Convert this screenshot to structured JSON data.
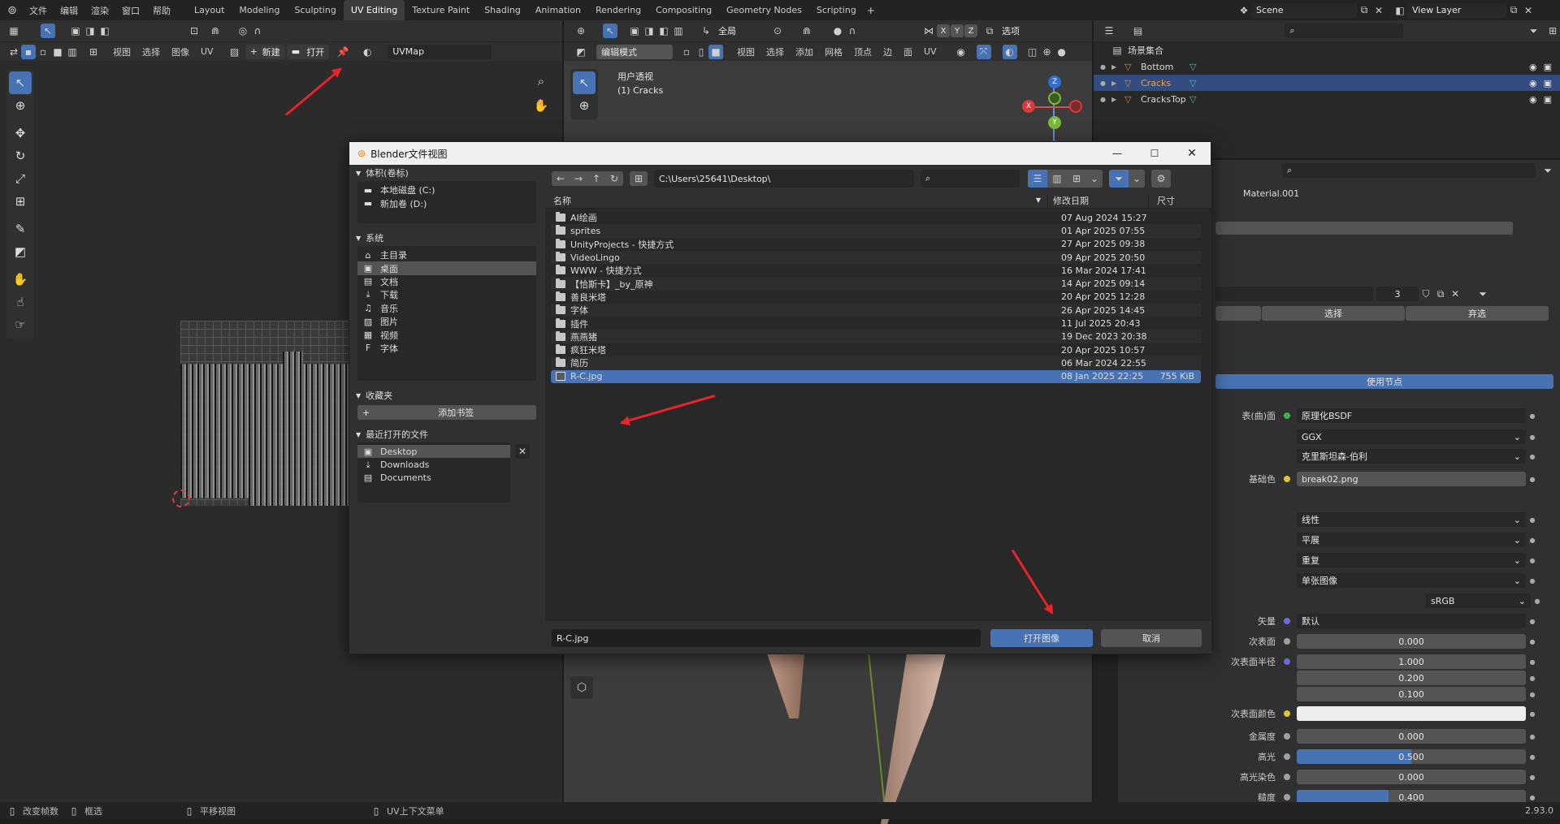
{
  "topbar": {
    "menus": [
      "文件",
      "编辑",
      "渲染",
      "窗口",
      "帮助"
    ],
    "workspaces": [
      "Layout",
      "Modeling",
      "Sculpting",
      "UV Editing",
      "Texture Paint",
      "Shading",
      "Animation",
      "Rendering",
      "Compositing",
      "Geometry Nodes",
      "Scripting"
    ],
    "active_workspace": "UV Editing",
    "scene": "Scene",
    "view_layer": "View Layer"
  },
  "uv_editor": {
    "menus": [
      "视图",
      "选择",
      "图像",
      "UV"
    ],
    "new_label": "新建",
    "open_label": "打开",
    "uvmap": "UVMap"
  },
  "viewport": {
    "mode": "编辑模式",
    "menus": [
      "视图",
      "选择",
      "添加",
      "网格",
      "顶点",
      "边",
      "面",
      "UV"
    ],
    "transform": "全局",
    "options": "选项",
    "overlay_title": "用户透视",
    "overlay_object": "(1) Cracks",
    "axes": [
      "X",
      "Y",
      "Z"
    ]
  },
  "outliner": {
    "root": "场景集合",
    "items": [
      "Bottom",
      "Cracks",
      "CracksTop"
    ],
    "selected": "Cracks"
  },
  "properties": {
    "material": "Material.001",
    "slot_count": "3",
    "select_label": "选择",
    "deselect_label": "弃选",
    "use_nodes": "使用节点",
    "rows": [
      {
        "label": "表(曲)面",
        "value": "原理化BSDF",
        "kind": "field",
        "dot": "#3fb04e"
      },
      {
        "label": "",
        "value": "GGX",
        "kind": "dropdown"
      },
      {
        "label": "",
        "value": "克里斯坦森-伯利",
        "kind": "dropdown"
      },
      {
        "label": "基础色",
        "value": "break02.png",
        "kind": "field",
        "dot": "#d8c63a"
      },
      {
        "label": "",
        "value": "线性",
        "kind": "dropdown"
      },
      {
        "label": "",
        "value": "平展",
        "kind": "dropdown"
      },
      {
        "label": "",
        "value": "重复",
        "kind": "dropdown"
      },
      {
        "label": "",
        "value": "单张图像",
        "kind": "dropdown"
      },
      {
        "label": "",
        "value": "sRGB",
        "kind": "dropdown"
      },
      {
        "label": "矢量",
        "value": "默认",
        "kind": "field",
        "dot": "#6a6ad8"
      },
      {
        "label": "次表面",
        "value": "0.000",
        "kind": "num",
        "dot": "#a0a0a0"
      },
      {
        "label": "次表面半径",
        "value": "1.000",
        "kind": "num",
        "dot": "#6a6ad8"
      },
      {
        "label": "",
        "value": "0.200",
        "kind": "num"
      },
      {
        "label": "",
        "value": "0.100",
        "kind": "num"
      },
      {
        "label": "次表面颜色",
        "value": "",
        "kind": "color",
        "dot": "#d8c63a"
      },
      {
        "label": "金属度",
        "value": "0.000",
        "kind": "num",
        "dot": "#a0a0a0"
      },
      {
        "label": "高光",
        "value": "0.500",
        "kind": "numfill",
        "dot": "#a0a0a0",
        "fill": 0.5
      },
      {
        "label": "高光染色",
        "value": "0.000",
        "kind": "num",
        "dot": "#a0a0a0"
      },
      {
        "label": "糙度",
        "value": "0.400",
        "kind": "numfill",
        "dot": "#a0a0a0",
        "fill": 0.4
      }
    ]
  },
  "dialog": {
    "title": "Blender文件视图",
    "path": "C:\\Users\\25641\\Desktop\\",
    "search_placeholder": "",
    "sections": {
      "volumes": "体积(卷标)",
      "system": "系统",
      "bookmarks": "收藏夹",
      "recent": "最近打开的文件"
    },
    "volumes": [
      "本地磁盘 (C:)",
      "新加卷 (D:)"
    ],
    "system": [
      {
        "label": "主目录",
        "icon": "⌂"
      },
      {
        "label": "桌面",
        "icon": "▣"
      },
      {
        "label": "文档",
        "icon": "▤"
      },
      {
        "label": "下载",
        "icon": "⤓"
      },
      {
        "label": "音乐",
        "icon": "♫"
      },
      {
        "label": "图片",
        "icon": "▨"
      },
      {
        "label": "视频",
        "icon": "▦"
      },
      {
        "label": "字体",
        "icon": "F"
      }
    ],
    "system_selected": "桌面",
    "add_bookmark": "添加书签",
    "recent": [
      {
        "label": "Desktop",
        "icon": "▣"
      },
      {
        "label": "Downloads",
        "icon": "⤓"
      },
      {
        "label": "Documents",
        "icon": "▤"
      }
    ],
    "columns": {
      "name": "名称",
      "date": "修改日期",
      "size": "尺寸"
    },
    "files": [
      {
        "name": "AI绘画",
        "date": "07 Aug 2024 15:27",
        "size": "",
        "type": "folder"
      },
      {
        "name": "sprites",
        "date": "01 Apr 2025 07:55",
        "size": "",
        "type": "folder"
      },
      {
        "name": "UnityProjects - 快捷方式",
        "date": "27 Apr 2025 09:38",
        "size": "",
        "type": "folder"
      },
      {
        "name": "VideoLingo",
        "date": "09 Apr 2025 20:50",
        "size": "",
        "type": "folder"
      },
      {
        "name": "WWW - 快捷方式",
        "date": "16 Mar 2024 17:41",
        "size": "",
        "type": "folder"
      },
      {
        "name": "【恰斯卡】_by_原神",
        "date": "14 Apr 2025 09:14",
        "size": "",
        "type": "folder"
      },
      {
        "name": "善良米塔",
        "date": "20 Apr 2025 12:28",
        "size": "",
        "type": "folder"
      },
      {
        "name": "字体",
        "date": "26 Apr 2025 14:45",
        "size": "",
        "type": "folder"
      },
      {
        "name": "插件",
        "date": "11 Jul 2025 20:43",
        "size": "",
        "type": "folder"
      },
      {
        "name": "燕燕猪",
        "date": "19 Dec 2023 20:38",
        "size": "",
        "type": "folder"
      },
      {
        "name": "疯狂米塔",
        "date": "20 Apr 2025 10:57",
        "size": "",
        "type": "folder"
      },
      {
        "name": "简历",
        "date": "06 Mar 2024 22:55",
        "size": "",
        "type": "folder"
      },
      {
        "name": "R-C.jpg",
        "date": "08 Jan 2025 22:25",
        "size": "755 KiB",
        "type": "image"
      }
    ],
    "selected_file": "R-C.jpg",
    "filename": "R-C.jpg",
    "open_button": "打开图像",
    "cancel_button": "取消"
  },
  "statusbar": {
    "items": [
      "改变帧数",
      "框选",
      "平移视图",
      "UV上下文菜单"
    ],
    "version": "2.93.0"
  },
  "colors": {
    "accent": "#4772b3",
    "arrow": "#e8232a"
  }
}
